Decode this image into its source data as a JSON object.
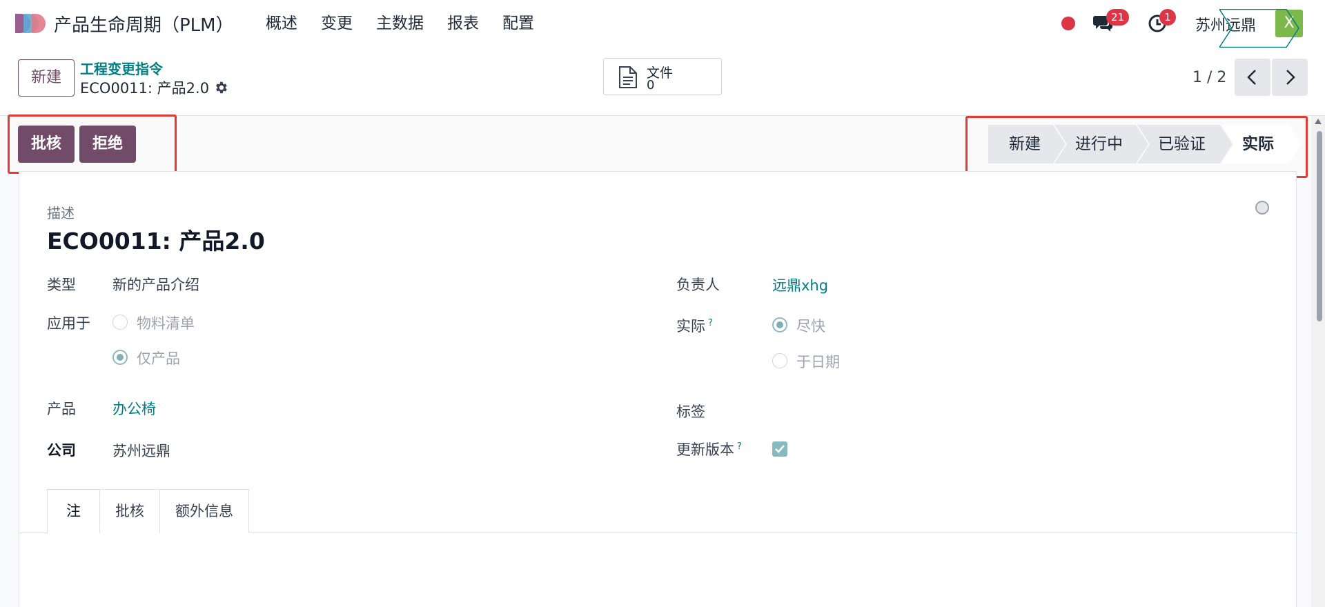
{
  "navbar": {
    "app_title": "产品生命周期（PLM）",
    "menu": [
      "概述",
      "变更",
      "主数据",
      "报表",
      "配置"
    ],
    "chat_badge": "21",
    "activity_badge": "1",
    "company": "苏州远鼎",
    "avatar_letter": "X",
    "colors": {
      "brand": "#714b67",
      "badge": "#dc3545",
      "avatar": "#7cb84a"
    }
  },
  "control_panel": {
    "new_button": "新建",
    "breadcrumb": "工程变更指令",
    "record_title": "ECO0011: 产品2.0",
    "smart_button": {
      "label": "文件",
      "value": "0",
      "icon": "document-icon"
    },
    "pager": "1 / 2"
  },
  "statusbar": {
    "buttons": [
      "批核",
      "拒绝"
    ],
    "stages": [
      "新建",
      "进行中",
      "已验证",
      "实际"
    ],
    "current_stage": "实际"
  },
  "form": {
    "description_label": "描述",
    "name": "ECO0011: 产品2.0",
    "type_label": "类型",
    "type_value": "新的产品介绍",
    "apply_on_label": "应用于",
    "apply_on_options": [
      "物料清单",
      "仅产品"
    ],
    "apply_on_selected": "仅产品",
    "product_label": "产品",
    "product_value": "办公椅",
    "company_label": "公司",
    "company_value": "苏州远鼎",
    "responsible_label": "负责人",
    "responsible_value": "远鼎xhg",
    "effective_label": "实际",
    "effective_options": [
      "尽快",
      "于日期"
    ],
    "effective_selected": "尽快",
    "tags_label": "标签",
    "update_version_label": "更新版本",
    "update_version_checked": true,
    "help_mark": "?"
  },
  "tabs": [
    "注",
    "批核",
    "额外信息"
  ],
  "active_tab": "注"
}
